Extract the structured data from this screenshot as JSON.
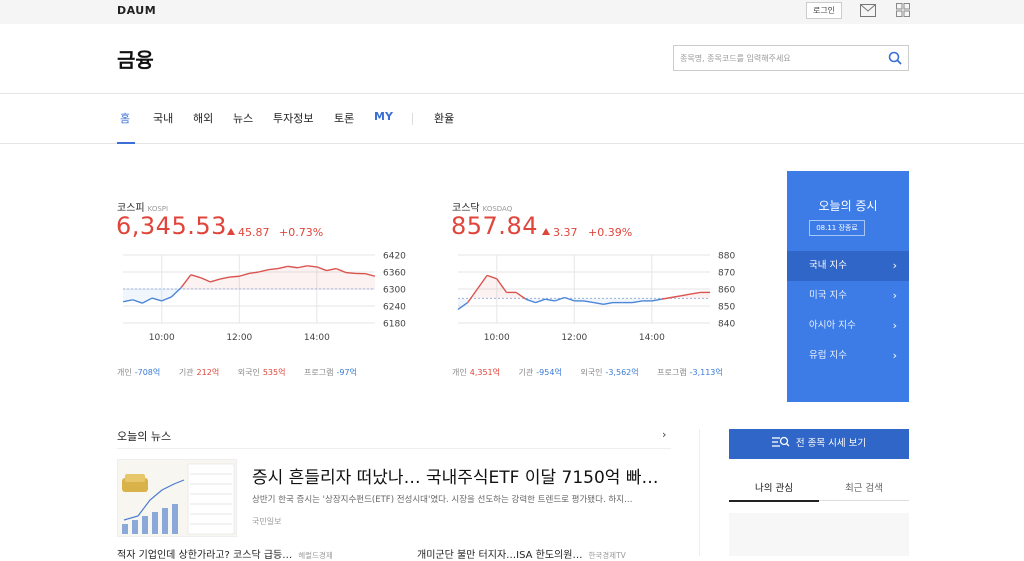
{
  "topbar": {
    "logo": "DAUM",
    "login_label": "로그인"
  },
  "header": {
    "title": "금융",
    "search_placeholder": "종목명, 종목코드를 입력해주세요"
  },
  "nav": {
    "items": [
      {
        "label": "홈"
      },
      {
        "label": "국내"
      },
      {
        "label": "해외"
      },
      {
        "label": "뉴스"
      },
      {
        "label": "투자정보"
      },
      {
        "label": "토론"
      },
      {
        "label": "MY"
      },
      {
        "label": "환율"
      }
    ]
  },
  "kospi": {
    "name": "코스피",
    "name_en": "KOSPI",
    "value": "6,345.53",
    "change": "45.87",
    "pct": "+0.73%",
    "investors": [
      {
        "label": "개인",
        "value": "-708억"
      },
      {
        "label": "기관",
        "value": "212억"
      },
      {
        "label": "외국인",
        "value": "535억"
      },
      {
        "label": "프로그램",
        "value": "-97억"
      }
    ]
  },
  "kosdaq": {
    "name": "코스닥",
    "name_en": "KOSDAQ",
    "value": "857.84",
    "change": "3.37",
    "pct": "+0.39%",
    "investors": [
      {
        "label": "개인",
        "value": "4,351억"
      },
      {
        "label": "기관",
        "value": "-954억"
      },
      {
        "label": "외국인",
        "value": "-3,562억"
      },
      {
        "label": "프로그램",
        "value": "-3,113억"
      }
    ]
  },
  "chart_data": [
    {
      "type": "line",
      "title": "코스피",
      "x_ticks": [
        "10:00",
        "12:00",
        "14:00"
      ],
      "y_ticks": [
        6420,
        6360,
        6300,
        6240,
        6180
      ],
      "ylim": [
        6180,
        6420
      ],
      "baseline": 6300,
      "x": [
        9.0,
        9.25,
        9.5,
        9.75,
        10.0,
        10.25,
        10.5,
        10.75,
        11.0,
        11.25,
        11.5,
        11.75,
        12.0,
        12.25,
        12.5,
        12.75,
        13.0,
        13.25,
        13.5,
        13.75,
        14.0,
        14.25,
        14.5,
        14.75,
        15.0,
        15.25,
        15.5
      ],
      "values": [
        6255,
        6262,
        6250,
        6268,
        6258,
        6272,
        6305,
        6350,
        6340,
        6325,
        6335,
        6342,
        6345,
        6355,
        6360,
        6368,
        6372,
        6380,
        6375,
        6382,
        6378,
        6365,
        6372,
        6358,
        6355,
        6354,
        6345
      ]
    },
    {
      "type": "line",
      "title": "코스닥",
      "x_ticks": [
        "10:00",
        "12:00",
        "14:00"
      ],
      "y_ticks": [
        880,
        870,
        860,
        850,
        840
      ],
      "ylim": [
        840,
        880
      ],
      "baseline": 854.5,
      "x": [
        9.0,
        9.25,
        9.5,
        9.75,
        10.0,
        10.25,
        10.5,
        10.75,
        11.0,
        11.25,
        11.5,
        11.75,
        12.0,
        12.25,
        12.5,
        12.75,
        13.0,
        13.25,
        13.5,
        13.75,
        14.0,
        14.25,
        14.5,
        14.75,
        15.0,
        15.25,
        15.5
      ],
      "values": [
        848,
        852,
        860,
        868,
        866,
        858,
        858,
        854,
        852,
        854,
        853,
        855,
        853,
        853,
        852,
        851,
        852,
        852,
        852,
        853,
        853,
        854,
        855,
        856,
        857,
        858,
        858
      ]
    }
  ],
  "panel": {
    "title": "오늘의 증시",
    "date": "08.11 장종료",
    "items": [
      {
        "label": "국내 지수"
      },
      {
        "label": "미국 지수"
      },
      {
        "label": "아시아 지수"
      },
      {
        "label": "유럽 지수"
      }
    ]
  },
  "news": {
    "section_title": "오늘의 뉴스",
    "headline": "증시 흔들리자 떠났나… 국내주식ETF 이달 7150억 빠…",
    "summary": "상반기 한국 증시는 '상장지수펀드(ETF) 전성시대'였다. 시장을 선도하는 강력한 트렌드로 평가됐다. 하지…",
    "source": "국민일보",
    "sub": [
      {
        "title": "적자 기업인데 상한가라고? 코스닥 급등…",
        "source": "헤럴드경제"
      },
      {
        "title": "개미군단 불만 터지자…ISA 한도의원…",
        "source": "한국경제TV"
      }
    ]
  },
  "sidebar": {
    "all_quotes_label": "전 종목 시세 보기",
    "tabs": [
      {
        "label": "나의 관심"
      },
      {
        "label": "최근 검색"
      }
    ]
  }
}
